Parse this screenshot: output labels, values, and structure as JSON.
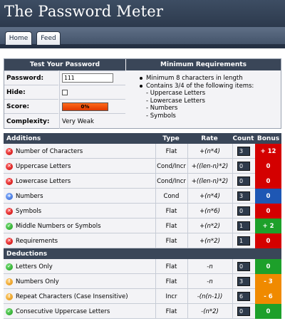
{
  "header": {
    "title": "The Password Meter",
    "nav": [
      {
        "label": "Home"
      },
      {
        "label": "Feed"
      }
    ]
  },
  "test": {
    "title": "Test Your Password",
    "password_label": "Password:",
    "password_value": "111",
    "hide_label": "Hide:",
    "hide_checked": false,
    "score_label": "Score:",
    "score_value": "0%",
    "complexity_label": "Complexity:",
    "complexity_value": "Very Weak"
  },
  "requirements": {
    "title": "Minimum Requirements",
    "items": [
      "Minimum 8 characters in length",
      "Contains 3/4 of the following items:"
    ],
    "subitems": [
      "- Uppercase Letters",
      "- Lowercase Letters",
      "- Numbers",
      "- Symbols"
    ]
  },
  "table": {
    "columns": {
      "type": "Type",
      "rate": "Rate",
      "count": "Count",
      "bonus": "Bonus"
    },
    "additions_label": "Additions",
    "deductions_label": "Deductions",
    "additions": [
      {
        "status": "fail",
        "name": "Number of Characters",
        "type": "Flat",
        "rate": "+(n*4)",
        "count": "3",
        "bonus": "+ 12",
        "bonus_color": "red"
      },
      {
        "status": "fail",
        "name": "Uppercase Letters",
        "type": "Cond/Incr",
        "rate": "+((len-n)*2)",
        "count": "0",
        "bonus": "0",
        "bonus_color": "red"
      },
      {
        "status": "fail",
        "name": "Lowercase Letters",
        "type": "Cond/Incr",
        "rate": "+((len-n)*2)",
        "count": "0",
        "bonus": "0",
        "bonus_color": "red"
      },
      {
        "status": "exceed",
        "name": "Numbers",
        "type": "Cond",
        "rate": "+(n*4)",
        "count": "3",
        "bonus": "0",
        "bonus_color": "blue"
      },
      {
        "status": "fail",
        "name": "Symbols",
        "type": "Flat",
        "rate": "+(n*6)",
        "count": "0",
        "bonus": "0",
        "bonus_color": "red"
      },
      {
        "status": "pass",
        "name": "Middle Numbers or Symbols",
        "type": "Flat",
        "rate": "+(n*2)",
        "count": "1",
        "bonus": "+ 2",
        "bonus_color": "green"
      },
      {
        "status": "fail",
        "name": "Requirements",
        "type": "Flat",
        "rate": "+(n*2)",
        "count": "1",
        "bonus": "0",
        "bonus_color": "red"
      }
    ],
    "deductions": [
      {
        "status": "pass",
        "name": "Letters Only",
        "type": "Flat",
        "rate": "-n",
        "count": "0",
        "bonus": "0",
        "bonus_color": "green"
      },
      {
        "status": "warn",
        "name": "Numbers Only",
        "type": "Flat",
        "rate": "-n",
        "count": "3",
        "bonus": "- 3",
        "bonus_color": "orange"
      },
      {
        "status": "warn",
        "name": "Repeat Characters (Case Insensitive)",
        "type": "Incr",
        "rate": "-(n(n-1))",
        "count": "6",
        "bonus": "- 6",
        "bonus_color": "orange"
      },
      {
        "status": "pass",
        "name": "Consecutive Uppercase Letters",
        "type": "Flat",
        "rate": "-(n*2)",
        "count": "0",
        "bonus": "0",
        "bonus_color": "green"
      }
    ]
  },
  "colors": {
    "red": "#d40000",
    "green": "#1da02a",
    "blue": "#1e57b4",
    "orange": "#f08a00",
    "header": "#3a4658"
  }
}
